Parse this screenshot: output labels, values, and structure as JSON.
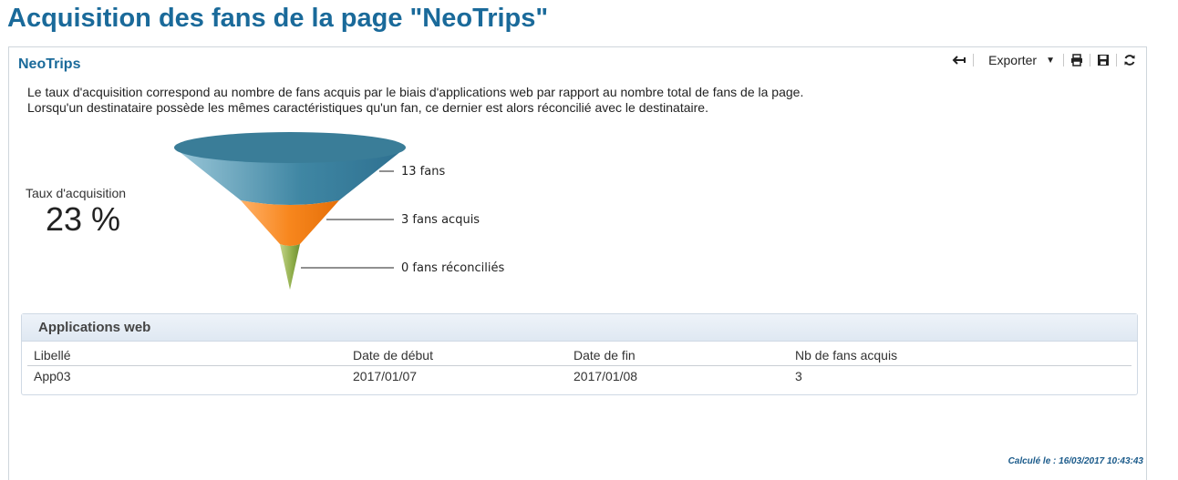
{
  "page": {
    "title": "Acquisition des fans de la page \"NeoTrips\""
  },
  "panel": {
    "title": "NeoTrips",
    "toolbar": {
      "back_icon": "arrow-left-icon",
      "export_label": "Exporter",
      "print_icon": "print-icon",
      "save_icon": "save-icon",
      "refresh_icon": "refresh-icon"
    },
    "description": [
      "Le taux d'acquisition correspond au nombre de fans acquis par le biais d'applications web par rapport au nombre total de fans de la page.",
      "Lorsqu'un destinataire possède les mêmes caractéristiques qu'un fan, ce dernier est alors réconcilié avec le destinataire."
    ],
    "acquisition": {
      "label": "Taux d'acquisition",
      "value": "23 %"
    },
    "funnel": {
      "colors": [
        "#3f86a3",
        "#f7861d",
        "#8fae4a"
      ],
      "stages": [
        {
          "label": "13 fans",
          "value": 13
        },
        {
          "label": "3 fans acquis",
          "value": 3
        },
        {
          "label": "0 fans réconciliés",
          "value": 0
        }
      ]
    },
    "apps": {
      "title": "Applications web",
      "columns": [
        "Libellé",
        "Date de début",
        "Date de fin",
        "Nb de fans acquis"
      ],
      "rows": [
        [
          "App03",
          "2017/01/07",
          "2017/01/08",
          "3"
        ]
      ]
    },
    "computed": "Calculé le : 16/03/2017 10:43:43"
  }
}
